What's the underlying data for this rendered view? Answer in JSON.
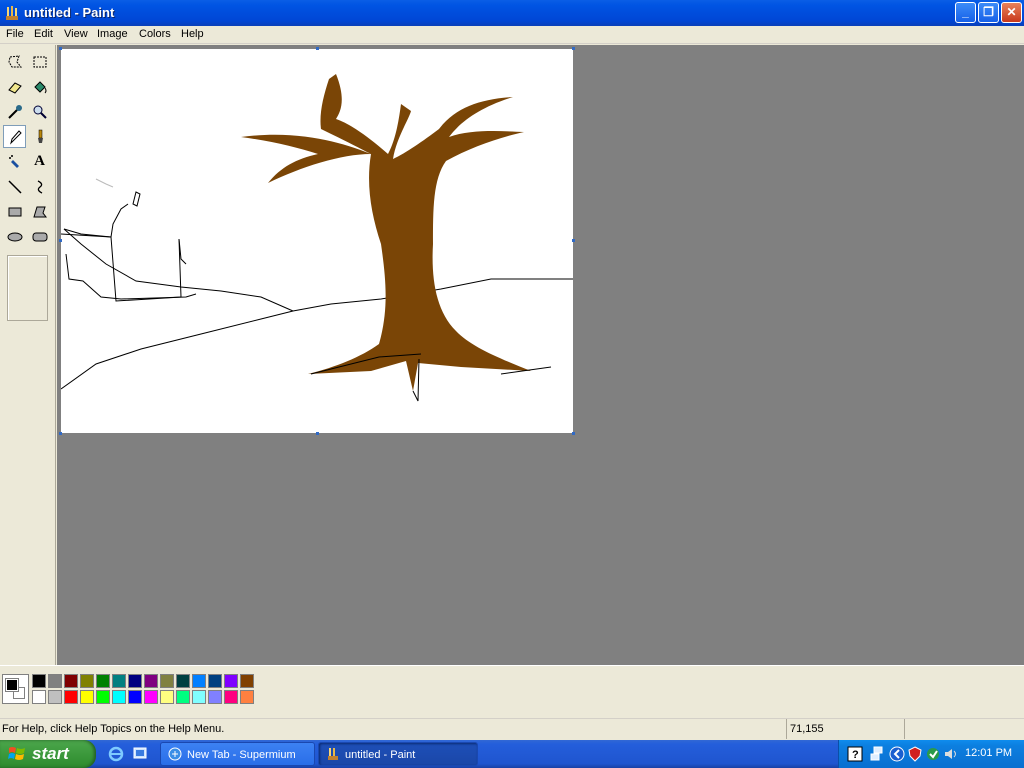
{
  "window": {
    "title": "untitled - Paint"
  },
  "menu": [
    "File",
    "Edit",
    "View",
    "Image",
    "Colors",
    "Help"
  ],
  "tools": [
    "free-select",
    "rect-select",
    "eraser",
    "fill",
    "color-picker",
    "magnifier",
    "pencil",
    "brush",
    "airbrush",
    "text",
    "line",
    "curve",
    "rectangle",
    "polygon",
    "ellipse",
    "rounded-rectangle"
  ],
  "selected_tool": "pencil",
  "palette": {
    "foreground": "#000000",
    "background": "#ffffff",
    "row1": [
      "#000000",
      "#808080",
      "#800000",
      "#808000",
      "#008000",
      "#008080",
      "#000080",
      "#800080",
      "#808040",
      "#004040",
      "#0080ff",
      "#004080",
      "#8000ff",
      "#804000"
    ],
    "row2": [
      "#ffffff",
      "#c0c0c0",
      "#ff0000",
      "#ffff00",
      "#00ff00",
      "#00ffff",
      "#0000ff",
      "#ff00ff",
      "#ffff80",
      "#00ff80",
      "#80ffff",
      "#8080ff",
      "#ff0080",
      "#ff8040"
    ]
  },
  "canvas": {
    "tree_color": "#7a4506"
  },
  "status": {
    "help": "For Help, click Help Topics on the Help Menu.",
    "coords": "71,155"
  },
  "taskbar": {
    "start_label": "start",
    "tasks": [
      {
        "label": "New Tab - Supermium",
        "active": false
      },
      {
        "label": "untitled - Paint",
        "active": true
      }
    ],
    "clock": "12:01 PM"
  }
}
